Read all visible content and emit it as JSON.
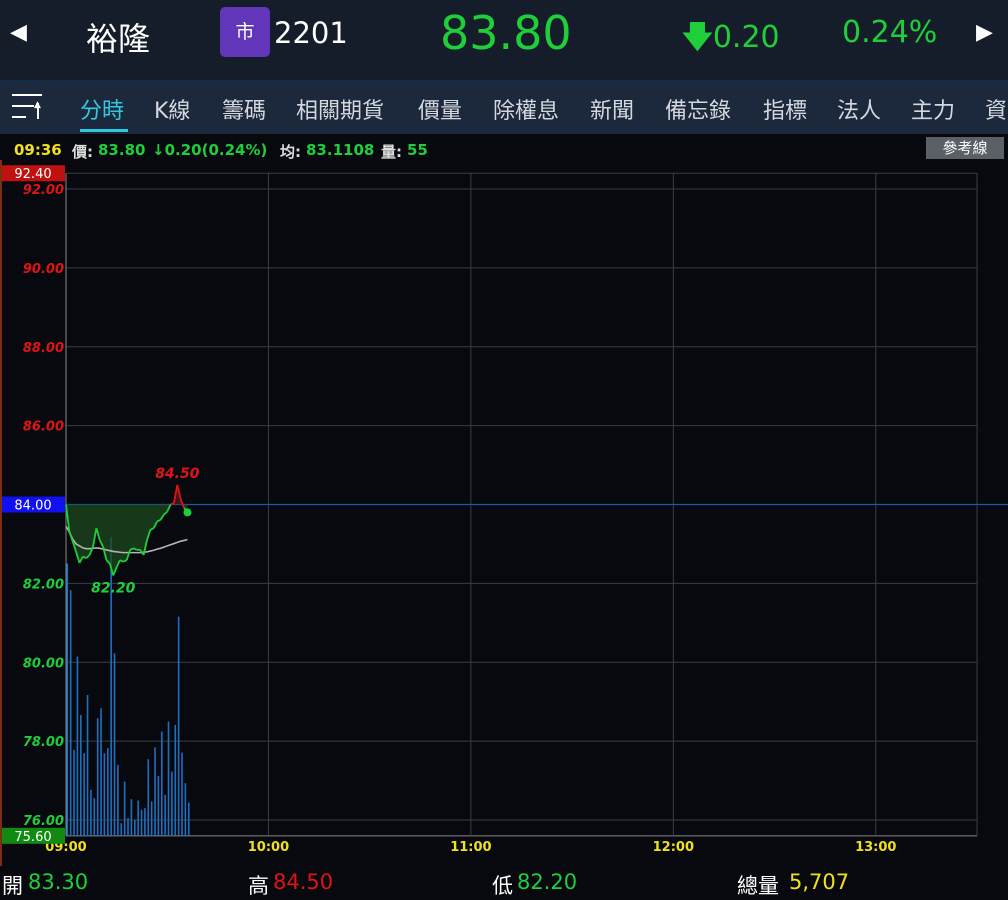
{
  "header": {
    "name": "裕隆",
    "market_badge": "市",
    "code": "2201",
    "price": "83.80",
    "change": "0.20",
    "change_pct": "0.24%",
    "prev_icon": "left-triangle-icon",
    "next_icon": "right-triangle-icon"
  },
  "tabs": [
    "分時",
    "K線",
    "籌碼",
    "相關期貨",
    "價量",
    "除權息",
    "新聞",
    "備忘錄",
    "指標",
    "法人",
    "主力",
    "資"
  ],
  "active_tab": 0,
  "info_bar": {
    "time": "09:36",
    "price_label": "價:",
    "price": "83.80",
    "change": "0.20(0.24%)",
    "avg_label": "均:",
    "avg": "83.1108",
    "vol_label": "量:",
    "vol": "55",
    "ref_button": "參考線"
  },
  "footer": {
    "open_label": "開",
    "open": "83.30",
    "high_label": "高",
    "high": "84.50",
    "low_label": "低",
    "low": "82.20",
    "vol_label": "總量",
    "vol": "5,707"
  },
  "colors": {
    "up": "#e01414",
    "down": "#1fcf3a",
    "ref": "#1838ff",
    "volume": "#1e6fc0",
    "avg": "#b4b4b4",
    "time": "#f0e020"
  },
  "chart_data": {
    "type": "line",
    "ylim": [
      75.6,
      92.4
    ],
    "ref_price": 84.0,
    "y_ticks": [
      "92.00",
      "90.00",
      "88.00",
      "86.00",
      "84.00",
      "82.00",
      "80.00",
      "78.00",
      "76.00"
    ],
    "y_tick_values": [
      92,
      90,
      88,
      86,
      84,
      82,
      80,
      78,
      76
    ],
    "top_label": "92.40",
    "bottom_label": "75.60",
    "ref_label": "84.00",
    "x_ticks": [
      "09:00",
      "10:00",
      "11:00",
      "12:00",
      "13:00"
    ],
    "x_minutes_range": [
      0,
      270
    ],
    "high_label": "84.50",
    "low_label": "82.20",
    "price": [
      84.0,
      83.31,
      83.06,
      82.8,
      82.52,
      82.68,
      82.64,
      82.72,
      82.93,
      83.4,
      83.1,
      82.93,
      82.59,
      82.5,
      82.2,
      82.41,
      82.59,
      82.55,
      82.59,
      82.85,
      82.89,
      82.85,
      82.85,
      82.72,
      83.1,
      83.36,
      83.4,
      83.57,
      83.61,
      83.74,
      83.82,
      84.0,
      84.04,
      84.5,
      84.13,
      83.91,
      83.8
    ],
    "avg": [
      83.45,
      83.3,
      83.12,
      83.0,
      82.95,
      82.9,
      82.88,
      82.88,
      82.89,
      82.9,
      82.89,
      82.87,
      82.85,
      82.83,
      82.81,
      82.8,
      82.79,
      82.78,
      82.78,
      82.78,
      82.78,
      82.78,
      82.78,
      82.79,
      82.8,
      82.82,
      82.84,
      82.87,
      82.89,
      82.92,
      82.95,
      82.98,
      83.01,
      83.04,
      83.07,
      83.09,
      83.11
    ],
    "volume": [
      818,
      738,
      258,
      538,
      363,
      248,
      423,
      138,
      113,
      353,
      383,
      248,
      263,
      898,
      548,
      213,
      38,
      163,
      53,
      110,
      48,
      106,
      78,
      83,
      230,
      103,
      266,
      180,
      313,
      123,
      343,
      193,
      333,
      658,
      250,
      158,
      100
    ]
  }
}
